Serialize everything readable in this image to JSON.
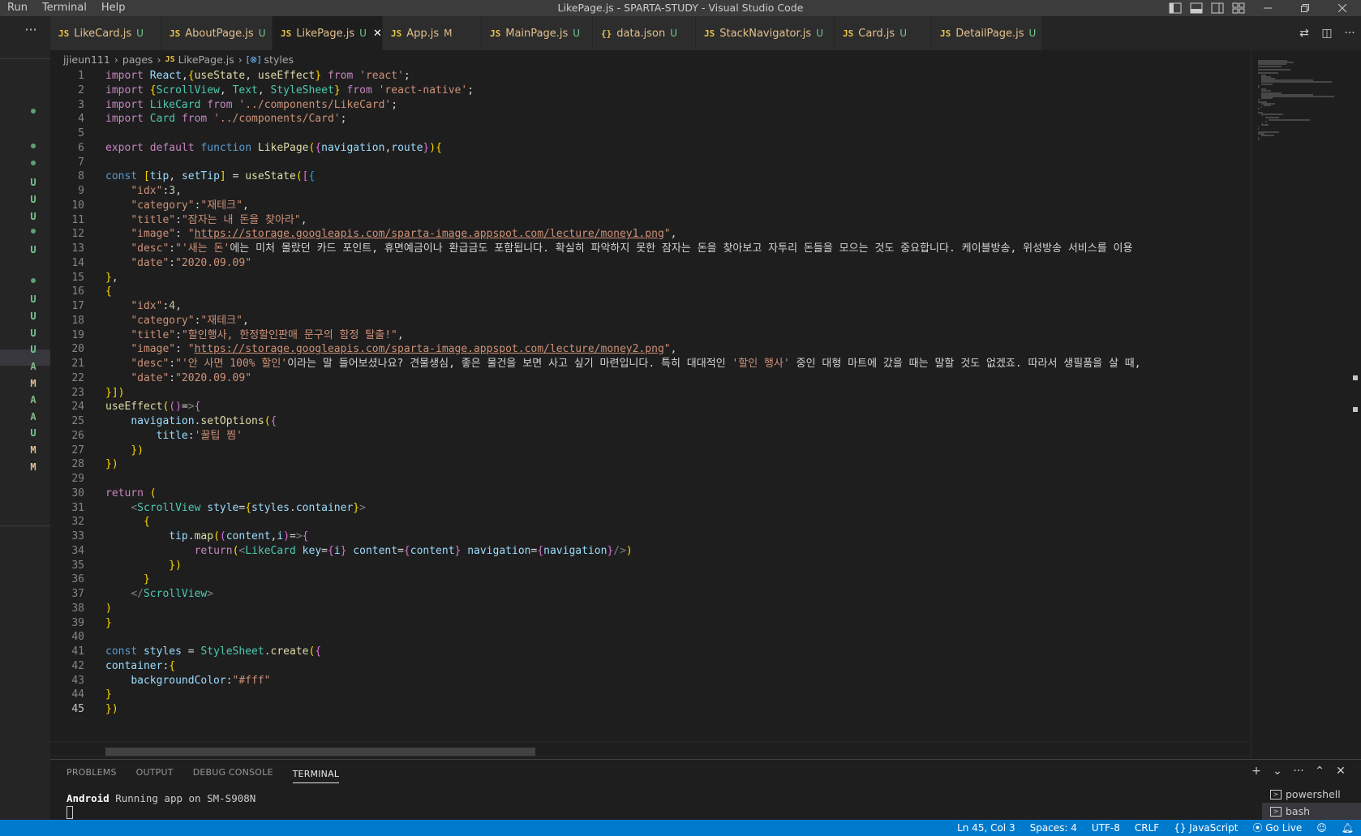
{
  "menu": [
    "Run",
    "Terminal",
    "Help"
  ],
  "window_title": "LikePage.js - SPARTA-STUDY - Visual Studio Code",
  "tabs": [
    {
      "name": "LikeCard.js",
      "badge": "U",
      "modified": false,
      "active": false
    },
    {
      "name": "AboutPage.js",
      "badge": "U",
      "modified": false,
      "active": false
    },
    {
      "name": "LikePage.js",
      "badge": "U",
      "modified": false,
      "active": true
    },
    {
      "name": "App.js",
      "badge": "M",
      "modified": true,
      "active": false
    },
    {
      "name": "MainPage.js",
      "badge": "U",
      "modified": false,
      "active": false
    },
    {
      "name": "data.json",
      "badge": "U",
      "modified": false,
      "active": false
    },
    {
      "name": "StackNavigator.js",
      "badge": "U",
      "modified": false,
      "active": false
    },
    {
      "name": "Card.js",
      "badge": "U",
      "modified": false,
      "active": false
    },
    {
      "name": "DetailPage.js",
      "badge": "U",
      "modified": false,
      "active": false
    }
  ],
  "breadcrumb": {
    "root": "jjieun111",
    "folder": "pages",
    "file": "LikePage.js",
    "symbol": "styles"
  },
  "scm_marks": [
    "U",
    "U",
    "U",
    "U",
    "U",
    "U",
    "U",
    "U",
    "A",
    "M",
    "A",
    "A",
    "U",
    "M",
    "M"
  ],
  "code_lines": [
    "import React,{useState, useEffect} from 'react';",
    "import {ScrollView, Text, StyleSheet} from 'react-native';",
    "import LikeCard from '../components/LikeCard';",
    "import Card from '../components/Card';",
    "",
    "export default function LikePage({navigation,route}){",
    "",
    "const [tip, setTip] = useState([{",
    "    \"idx\":3,",
    "    \"category\":\"재테크\",",
    "    \"title\":\"잠자는 내 돈을 찾아라\",",
    "    \"image\": \"https://storage.googleapis.com/sparta-image.appspot.com/lecture/money1.png\",",
    "    \"desc\":\"'새는 돈'에는 미처 몰랐던 카드 포인트, 휴면예금이나 환급금도 포함됩니다. 확실히 파악하지 못한 잠자는 돈을 찾아보고 자투리 돈들을 모으는 것도 중요합니다. 케이블방송, 위성방송 서비스를 이용",
    "    \"date\":\"2020.09.09\"",
    "},",
    "{",
    "    \"idx\":4,",
    "    \"category\":\"재테크\",",
    "    \"title\":\"할인행사, 한정할인판매 문구의 함정 탈출!\",",
    "    \"image\": \"https://storage.googleapis.com/sparta-image.appspot.com/lecture/money2.png\",",
    "    \"desc\":\"'안 사면 100% 할인'이라는 말 들어보셨나요? 견물생심, 좋은 물건을 보면 사고 싶기 마련입니다. 특히 대대적인 '할인 행사' 중인 대형 마트에 갔을 때는 말할 것도 없겠죠. 따라서 생필품을 살 때,",
    "    \"date\":\"2020.09.09\"",
    "}])",
    "useEffect(()=>{",
    "    navigation.setOptions({",
    "        title:'꿀팁 찜'",
    "    })",
    "})",
    "",
    "return (",
    "    <ScrollView style={styles.container}>",
    "      {",
    "          tip.map((content,i)=>{",
    "              return(<LikeCard key={i} content={content} navigation={navigation}/>)",
    "          })",
    "      }",
    "    </ScrollView>",
    ")",
    "}",
    "",
    "const styles = StyleSheet.create({",
    "container:{",
    "    backgroundColor:\"#fff\"",
    "}",
    "})"
  ],
  "panel": {
    "tabs": [
      "PROBLEMS",
      "OUTPUT",
      "DEBUG CONSOLE",
      "TERMINAL"
    ],
    "active_tab": "TERMINAL",
    "terminal_bold": "Android",
    "terminal_text": " Running app on SM-S908N",
    "terminals": [
      "powershell",
      "bash"
    ]
  },
  "status": {
    "position": "Ln 45, Col 3",
    "spaces": "Spaces: 4",
    "encoding": "UTF-8",
    "eol": "CRLF",
    "language": "JavaScript",
    "golive": "Go Live"
  },
  "colors": {
    "accent": "#007acc",
    "untracked": "#73c991",
    "modified": "#e2c08d"
  }
}
